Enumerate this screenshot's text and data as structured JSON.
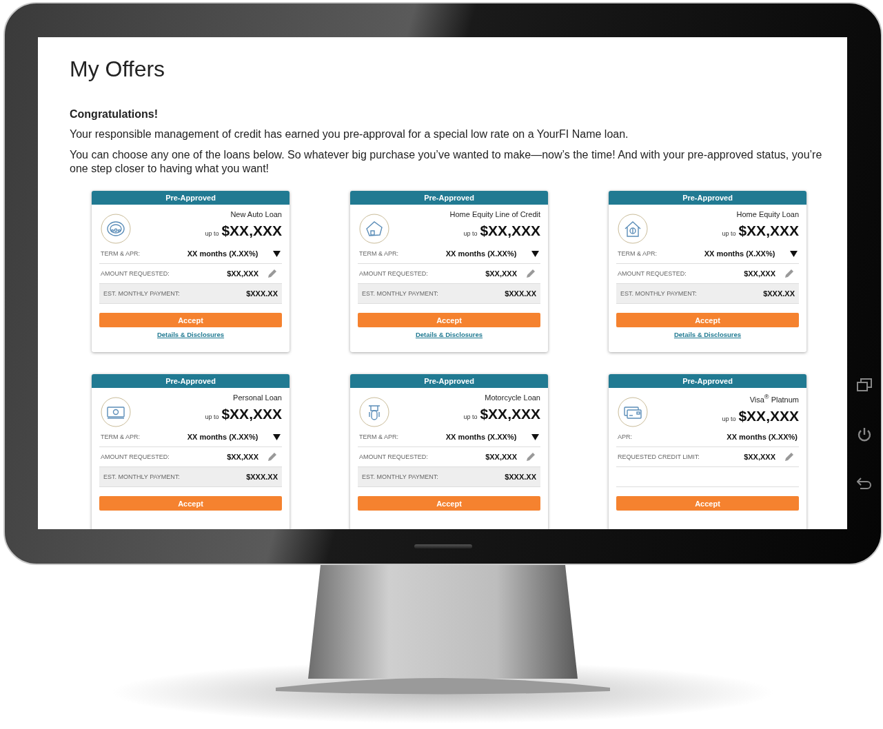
{
  "page": {
    "title": "My Offers",
    "heading": "Congratulations!",
    "paragraphs": [
      "Your responsible management of credit has earned you pre-approval for a special low rate on a YourFI Name loan.",
      "You can choose any one of the loans below. So whatever big purchase you’ve wanted to make—now’s the time! And with your pre-approved status, you’re one step closer to having what you want!"
    ]
  },
  "offers": [
    {
      "badge": "Pre-Approved",
      "product": "New Auto Loan",
      "prefix": "up to",
      "amount": "$XX,XXX",
      "rows": [
        {
          "kind": "select",
          "label": "TERM & APR:",
          "value": "XX months (X.XX%)"
        },
        {
          "kind": "edit",
          "label": "AMOUNT REQUESTED:",
          "value": "$XX,XXX"
        },
        {
          "kind": "total",
          "label": "EST. MONTHLY PAYMENT:",
          "value": "$XXX.XX"
        }
      ],
      "button": "Accept",
      "link": "Details & Disclosures"
    },
    {
      "badge": "Pre-Approved",
      "product": "Home Equity Line of Credit",
      "prefix": "up to",
      "amount": "$XX,XXX",
      "rows": [
        {
          "kind": "select",
          "label": "TERM & APR:",
          "value": "XX months (X.XX%)"
        },
        {
          "kind": "edit",
          "label": "AMOUNT REQUESTED:",
          "value": "$XX,XXX"
        },
        {
          "kind": "total",
          "label": "EST. MONTHLY PAYMENT:",
          "value": "$XXX.XX"
        }
      ],
      "button": "Accept",
      "link": "Details & Disclosures"
    },
    {
      "badge": "Pre-Approved",
      "product": "Home Equity Loan",
      "prefix": "up to",
      "amount": "$XX,XXX",
      "rows": [
        {
          "kind": "select",
          "label": "TERM & APR:",
          "value": "XX months (X.XX%)"
        },
        {
          "kind": "edit",
          "label": "AMOUNT REQUESTED:",
          "value": "$XX,XXX"
        },
        {
          "kind": "total",
          "label": "EST. MONTHLY PAYMENT:",
          "value": "$XXX.XX"
        }
      ],
      "button": "Accept",
      "link": "Details & Disclosures"
    },
    {
      "badge": "Pre-Approved",
      "product": "Personal Loan",
      "prefix": "up to",
      "amount": "$XX,XXX",
      "rows": [
        {
          "kind": "select",
          "label": "TERM & APR:",
          "value": "XX months (X.XX%)"
        },
        {
          "kind": "edit",
          "label": "AMOUNT REQUESTED:",
          "value": "$XX,XXX"
        },
        {
          "kind": "total",
          "label": "EST. MONTHLY PAYMENT:",
          "value": "$XXX.XX"
        }
      ],
      "button": "Accept"
    },
    {
      "badge": "Pre-Approved",
      "product": "Motorcycle Loan",
      "prefix": "up to",
      "amount": "$XX,XXX",
      "rows": [
        {
          "kind": "select",
          "label": "TERM & APR:",
          "value": "XX months (X.XX%)"
        },
        {
          "kind": "edit",
          "label": "AMOUNT REQUESTED:",
          "value": "$XX,XXX"
        },
        {
          "kind": "total",
          "label": "EST. MONTHLY PAYMENT:",
          "value": "$XXX.XX"
        }
      ],
      "button": "Accept"
    },
    {
      "badge": "Pre-Approved",
      "product": "Visa$^{®}$ Platnum",
      "prefix": "up to",
      "amount": "$XX,XXX",
      "rows": [
        {
          "kind": "plain",
          "label": "APR:",
          "value": "XX months (X.XX%)"
        },
        {
          "kind": "edit",
          "label": "REQUESTED CREDIT LIMIT:",
          "value": "$XX,XXX"
        }
      ],
      "button": "Accept"
    }
  ]
}
